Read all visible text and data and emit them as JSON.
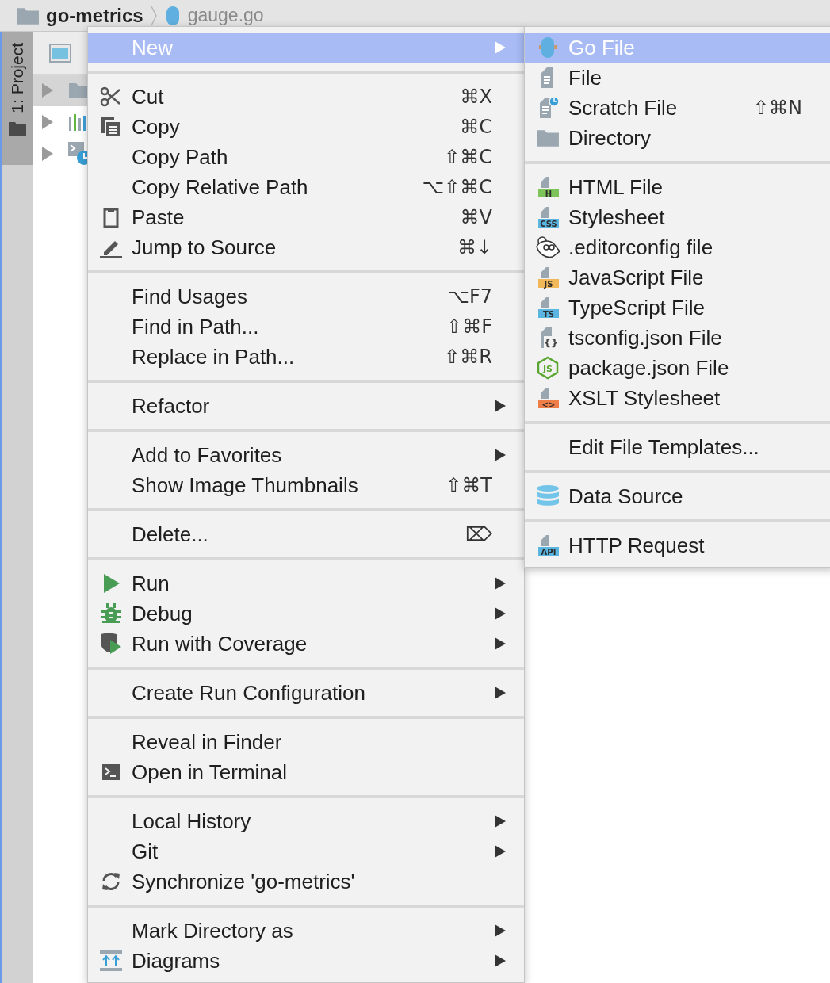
{
  "breadcrumb": {
    "project": "go-metrics",
    "file": "gauge.go"
  },
  "tool_window_strip": {
    "label": "1: Project",
    "selected": true
  },
  "project_panel": {
    "tree": [
      {
        "selected": true,
        "expanded": false
      },
      {
        "selected": false,
        "expanded": false
      },
      {
        "selected": false,
        "expanded": false
      }
    ]
  },
  "context_menu": {
    "groups": [
      {
        "items": [
          {
            "label": "New",
            "submenu": true,
            "selected": true
          }
        ]
      },
      {
        "items": [
          {
            "label": "Cut",
            "shortcut": "⌘X",
            "submenu": false,
            "selected": false
          },
          {
            "label": "Copy",
            "shortcut": "⌘C",
            "submenu": false,
            "selected": false
          },
          {
            "label": "Copy Path",
            "shortcut": "⇧⌘C",
            "submenu": false,
            "selected": false
          },
          {
            "label": "Copy Relative Path",
            "shortcut": "⌥⇧⌘C",
            "submenu": false,
            "selected": false
          },
          {
            "label": "Paste",
            "shortcut": "⌘V",
            "submenu": false,
            "selected": false
          },
          {
            "label": "Jump to Source",
            "shortcut": "⌘↓",
            "submenu": false,
            "selected": false
          }
        ]
      },
      {
        "items": [
          {
            "label": "Find Usages",
            "shortcut": "⌥F7",
            "submenu": false,
            "selected": false
          },
          {
            "label": "Find in Path...",
            "shortcut": "⇧⌘F",
            "submenu": false,
            "selected": false
          },
          {
            "label": "Replace in Path...",
            "shortcut": "⇧⌘R",
            "submenu": false,
            "selected": false
          }
        ]
      },
      {
        "items": [
          {
            "label": "Refactor",
            "submenu": true,
            "selected": false
          }
        ]
      },
      {
        "items": [
          {
            "label": "Add to Favorites",
            "submenu": true,
            "selected": false
          },
          {
            "label": "Show Image Thumbnails",
            "shortcut": "⇧⌘T",
            "submenu": false,
            "selected": false
          }
        ]
      },
      {
        "items": [
          {
            "label": "Delete...",
            "shortcut": "⌦",
            "submenu": false,
            "selected": false
          }
        ]
      },
      {
        "items": [
          {
            "label": "Run",
            "submenu": true,
            "selected": false
          },
          {
            "label": "Debug",
            "submenu": true,
            "selected": false
          },
          {
            "label": "Run with Coverage",
            "submenu": true,
            "selected": false
          }
        ]
      },
      {
        "items": [
          {
            "label": "Create Run Configuration",
            "submenu": true,
            "selected": false
          }
        ]
      },
      {
        "items": [
          {
            "label": "Reveal in Finder",
            "submenu": false,
            "selected": false
          },
          {
            "label": "Open in Terminal",
            "submenu": false,
            "selected": false
          }
        ]
      },
      {
        "items": [
          {
            "label": "Local History",
            "submenu": true,
            "selected": false
          },
          {
            "label": "Git",
            "submenu": true,
            "selected": false
          },
          {
            "label": "Synchronize 'go-metrics'",
            "submenu": false,
            "selected": false
          }
        ]
      },
      {
        "items": [
          {
            "label": "Mark Directory as",
            "submenu": true,
            "selected": false
          },
          {
            "label": "Diagrams",
            "submenu": true,
            "selected": false
          }
        ]
      }
    ]
  },
  "new_submenu": {
    "groups": [
      {
        "items": [
          {
            "label": "Go File",
            "selected": true
          },
          {
            "label": "File",
            "selected": false
          },
          {
            "label": "Scratch File",
            "shortcut": "⇧⌘N",
            "selected": false
          },
          {
            "label": "Directory",
            "selected": false
          }
        ]
      },
      {
        "items": [
          {
            "label": "HTML File",
            "badge": "H",
            "selected": false
          },
          {
            "label": "Stylesheet",
            "badge": "CSS",
            "selected": false
          },
          {
            "label": ".editorconfig file",
            "selected": false
          },
          {
            "label": "JavaScript File",
            "badge": "JS",
            "selected": false
          },
          {
            "label": "TypeScript File",
            "badge": "TS",
            "selected": false
          },
          {
            "label": "tsconfig.json File",
            "badge": "{}",
            "selected": false
          },
          {
            "label": "package.json File",
            "badge": "JS",
            "selected": false
          },
          {
            "label": "XSLT Stylesheet",
            "badge": "<>",
            "selected": false
          }
        ]
      },
      {
        "items": [
          {
            "label": "Edit File Templates...",
            "selected": false
          }
        ]
      },
      {
        "items": [
          {
            "label": "Data Source",
            "selected": false
          }
        ]
      },
      {
        "items": [
          {
            "label": "HTTP Request",
            "badge": "API",
            "selected": false
          }
        ]
      }
    ]
  }
}
